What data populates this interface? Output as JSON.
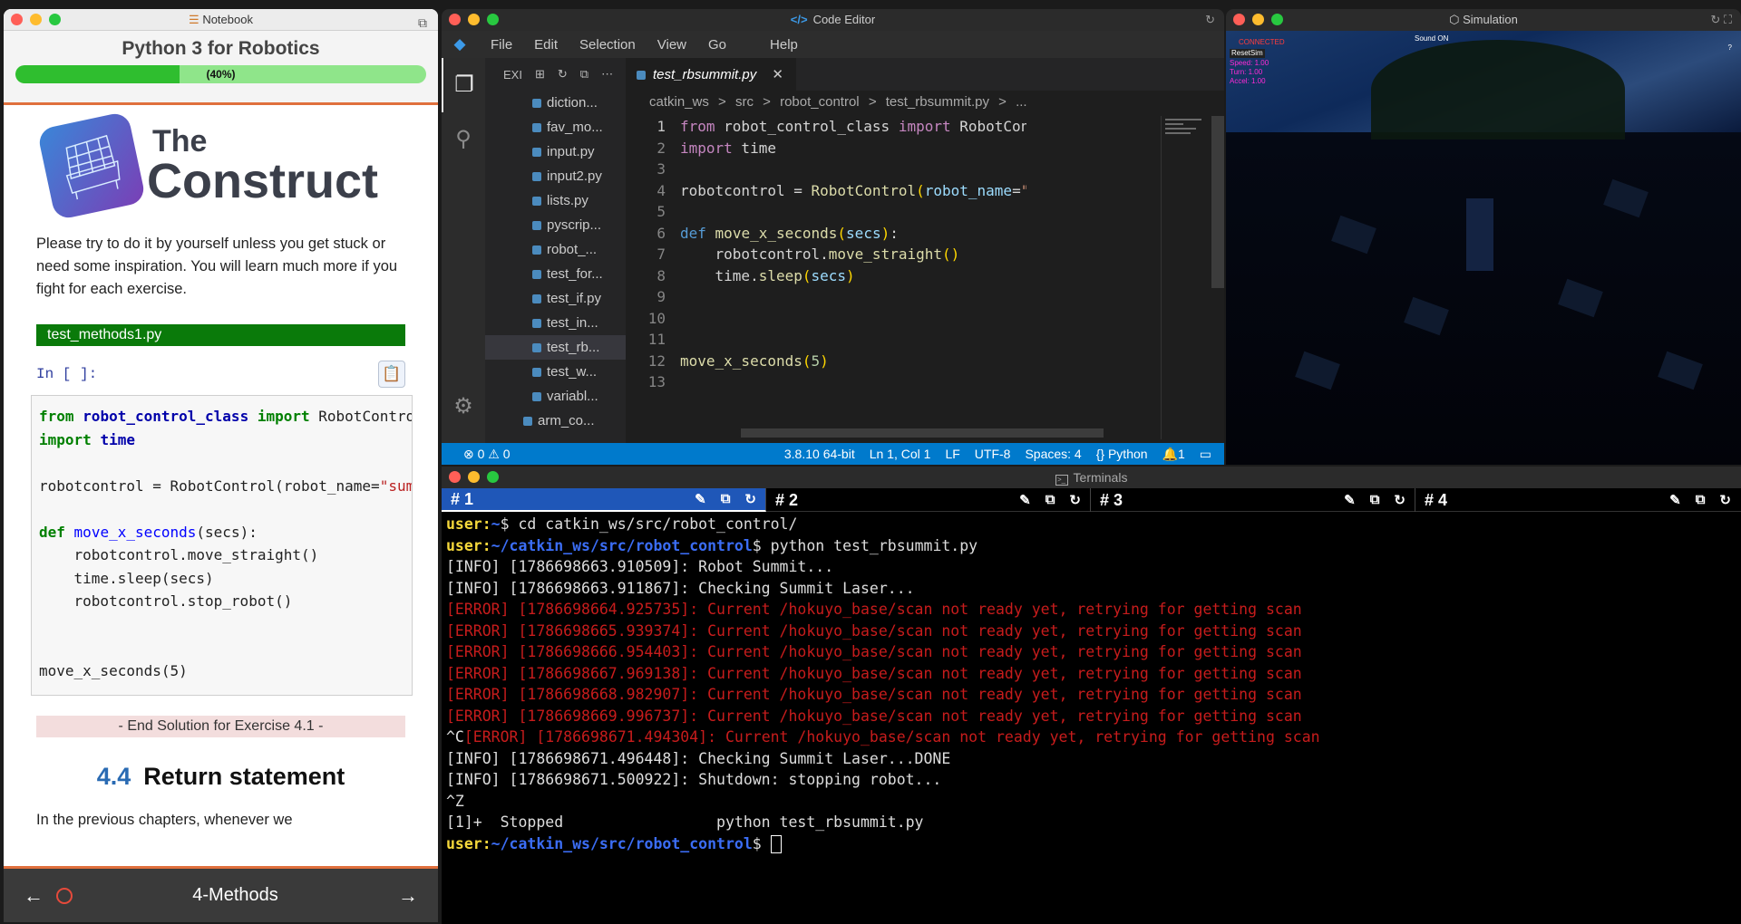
{
  "notebook": {
    "window_title": "Notebook",
    "title": "Python 3 for Robotics",
    "progress_label": "(40%)",
    "progress": 0.4,
    "logo_line1": "The",
    "logo_line2": "Construct",
    "intro": "Please try to do it by yourself unless you get stuck or need some inspiration. You will learn much more if you fight for each exercise.",
    "file_label": "test_methods1.py",
    "in_prompt": "In [ ]:",
    "code_lines": [
      "from robot_control_class import RobotControl",
      "import time",
      "",
      "robotcontrol = RobotControl(robot_name=\"summit\")",
      "",
      "def move_x_seconds(secs):",
      "    robotcontrol.move_straight()",
      "    time.sleep(secs)",
      "    robotcontrol.stop_robot()",
      "",
      "",
      "move_x_seconds(5)"
    ],
    "end_solution": "- End Solution for Exercise 4.1 -",
    "section_number": "4.4",
    "section_title": "Return statement",
    "next_para": "In the previous chapters, whenever we",
    "footer_title": "4-Methods",
    "colors": {
      "accent": "#e0703d",
      "progress": "#2fbe2f",
      "file_bar": "#0a7a0a"
    }
  },
  "editor": {
    "window_title": "Code Editor",
    "menu": [
      "File",
      "Edit",
      "Selection",
      "View",
      "Go",
      "Help"
    ],
    "explorer_label": "EXI",
    "files": [
      "diction...",
      "fav_mo...",
      "input.py",
      "input2.py",
      "lists.py",
      "pyscrip...",
      "robot_...",
      "test_for...",
      "test_if.py",
      "test_in...",
      "test_rb...",
      "test_w...",
      "variabl..."
    ],
    "folder": "arm_co...",
    "tab": "test_rbsummit.py",
    "breadcrumb": [
      "catkin_ws",
      ">",
      "src",
      ">",
      "robot_control",
      ">",
      "test_rbsummit.py",
      ">",
      "..."
    ],
    "line_numbers": [
      "1",
      "2",
      "3",
      "4",
      "5",
      "6",
      "7",
      "8",
      "9",
      "10",
      "11",
      "12",
      "13"
    ],
    "status_left": "⊗ 0 ⚠ 0",
    "status_right": [
      "3.8.10 64-bit",
      "Ln 1, Col 1",
      "LF",
      "UTF-8",
      "Spaces: 4",
      "{} Python",
      "🔔1",
      "▭"
    ]
  },
  "simulation": {
    "window_title": "Simulation",
    "hud_connected": "CONNECTED",
    "hud_reset": "ResetSim",
    "hud_speed": "Speed: 1.00",
    "hud_turn": "Turn: 1.00",
    "hud_accel": "Accel: 1.00",
    "hud_sound": "Sound ON",
    "hud_help": "?"
  },
  "terminals": {
    "window_title": "Terminals",
    "tabs": [
      "# 1",
      "# 2",
      "# 3",
      "# 4"
    ],
    "prompt_user": "user:",
    "lines": [
      {
        "user": "user:",
        "path": "~",
        "rest": "$ cd catkin_ws/src/robot_control/"
      },
      {
        "user": "user:",
        "path": "~/catkin_ws/src/robot_control",
        "rest": "$ python test_rbsummit.py"
      },
      {
        "text": "[INFO] [1786698663.910509]: Robot Summit..."
      },
      {
        "text": "[INFO] [1786698663.911867]: Checking Summit Laser..."
      },
      {
        "error": "[ERROR] [1786698664.925735]: Current /hokuyo_base/scan not ready yet, retrying for getting scan"
      },
      {
        "error": "[ERROR] [1786698665.939374]: Current /hokuyo_base/scan not ready yet, retrying for getting scan"
      },
      {
        "error": "[ERROR] [1786698666.954403]: Current /hokuyo_base/scan not ready yet, retrying for getting scan"
      },
      {
        "error": "[ERROR] [1786698667.969138]: Current /hokuyo_base/scan not ready yet, retrying for getting scan"
      },
      {
        "error": "[ERROR] [1786698668.982907]: Current /hokuyo_base/scan not ready yet, retrying for getting scan"
      },
      {
        "error": "[ERROR] [1786698669.996737]: Current /hokuyo_base/scan not ready yet, retrying for getting scan"
      },
      {
        "pre": "^C",
        "error": "[ERROR] [1786698671.494304]: Current /hokuyo_base/scan not ready yet, retrying for getting scan"
      },
      {
        "text": "[INFO] [1786698671.496448]: Checking Summit Laser...DONE"
      },
      {
        "text": "[INFO] [1786698671.500922]: Shutdown: stopping robot..."
      },
      {
        "text": "^Z"
      },
      {
        "text": "[1]+  Stopped                 python test_rbsummit.py"
      },
      {
        "user": "user:",
        "path": "~/catkin_ws/src/robot_control",
        "rest": "$ ",
        "cursor": true
      }
    ]
  }
}
